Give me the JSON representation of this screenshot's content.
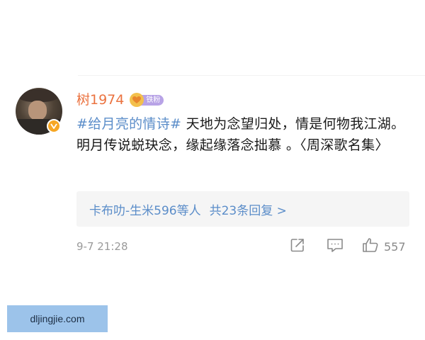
{
  "comment": {
    "username": "树1974",
    "fan_badge_label": "铁粉",
    "hashtag": "#给月亮的情诗#",
    "text": " 天地为念望归处，情是何物我江湖。明月传说蜕玦念，缘起缘落念拙慕 。〈周深歌名集〉",
    "timestamp": "9-7 21:28"
  },
  "replies": {
    "author_link": "卡布叻-生米596",
    "suffix": "等人",
    "count_text": "共23条回复 >"
  },
  "actions": {
    "share_icon": "share-icon",
    "comment_icon": "comment-icon",
    "like_icon": "thumbs-up-icon",
    "like_count": "557"
  },
  "watermark": {
    "text": "dljingjie.com"
  },
  "colors": {
    "username": "#eb7340",
    "link": "#5b8dc9",
    "meta_gray": "#9a9a9a",
    "verified_badge": "#f6a623",
    "fan_badge": "#b8a3e6"
  }
}
